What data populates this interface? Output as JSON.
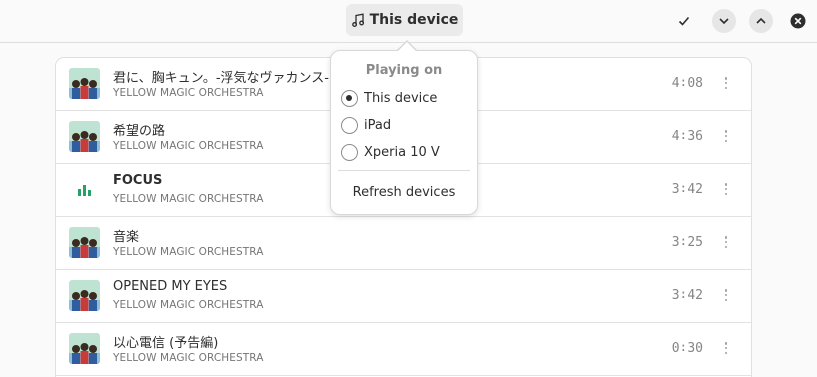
{
  "header": {
    "device_button_label": "This device",
    "icons": [
      "music-note-icon",
      "check-icon",
      "chevron-down-icon",
      "chevron-up-icon",
      "close-icon"
    ]
  },
  "popover": {
    "heading": "Playing on",
    "devices": [
      {
        "label": "This device",
        "selected": true
      },
      {
        "label": "iPad",
        "selected": false
      },
      {
        "label": "Xperia 10 V",
        "selected": false
      }
    ],
    "refresh_label": "Refresh devices"
  },
  "tracks": [
    {
      "title": "君に、胸キュン。-浮気なヴァカンス-",
      "artist": "YELLOW MAGIC ORCHESTRA",
      "duration": "4∶08",
      "playing": false
    },
    {
      "title": "希望の路",
      "artist": "YELLOW MAGIC ORCHESTRA",
      "duration": "4∶36",
      "playing": false
    },
    {
      "title": "FOCUS",
      "artist": "YELLOW MAGIC ORCHESTRA",
      "duration": "3∶42",
      "playing": true
    },
    {
      "title": "音楽",
      "artist": "YELLOW MAGIC ORCHESTRA",
      "duration": "3∶25",
      "playing": false
    },
    {
      "title": "OPENED MY EYES",
      "artist": "YELLOW MAGIC ORCHESTRA",
      "duration": "3∶42",
      "playing": false
    },
    {
      "title": "以心電信 (予告編)",
      "artist": "YELLOW MAGIC ORCHESTRA",
      "duration": "0∶30",
      "playing": false
    }
  ],
  "colors": {
    "accent_playing": "#26a269",
    "background": "#fafafa"
  }
}
